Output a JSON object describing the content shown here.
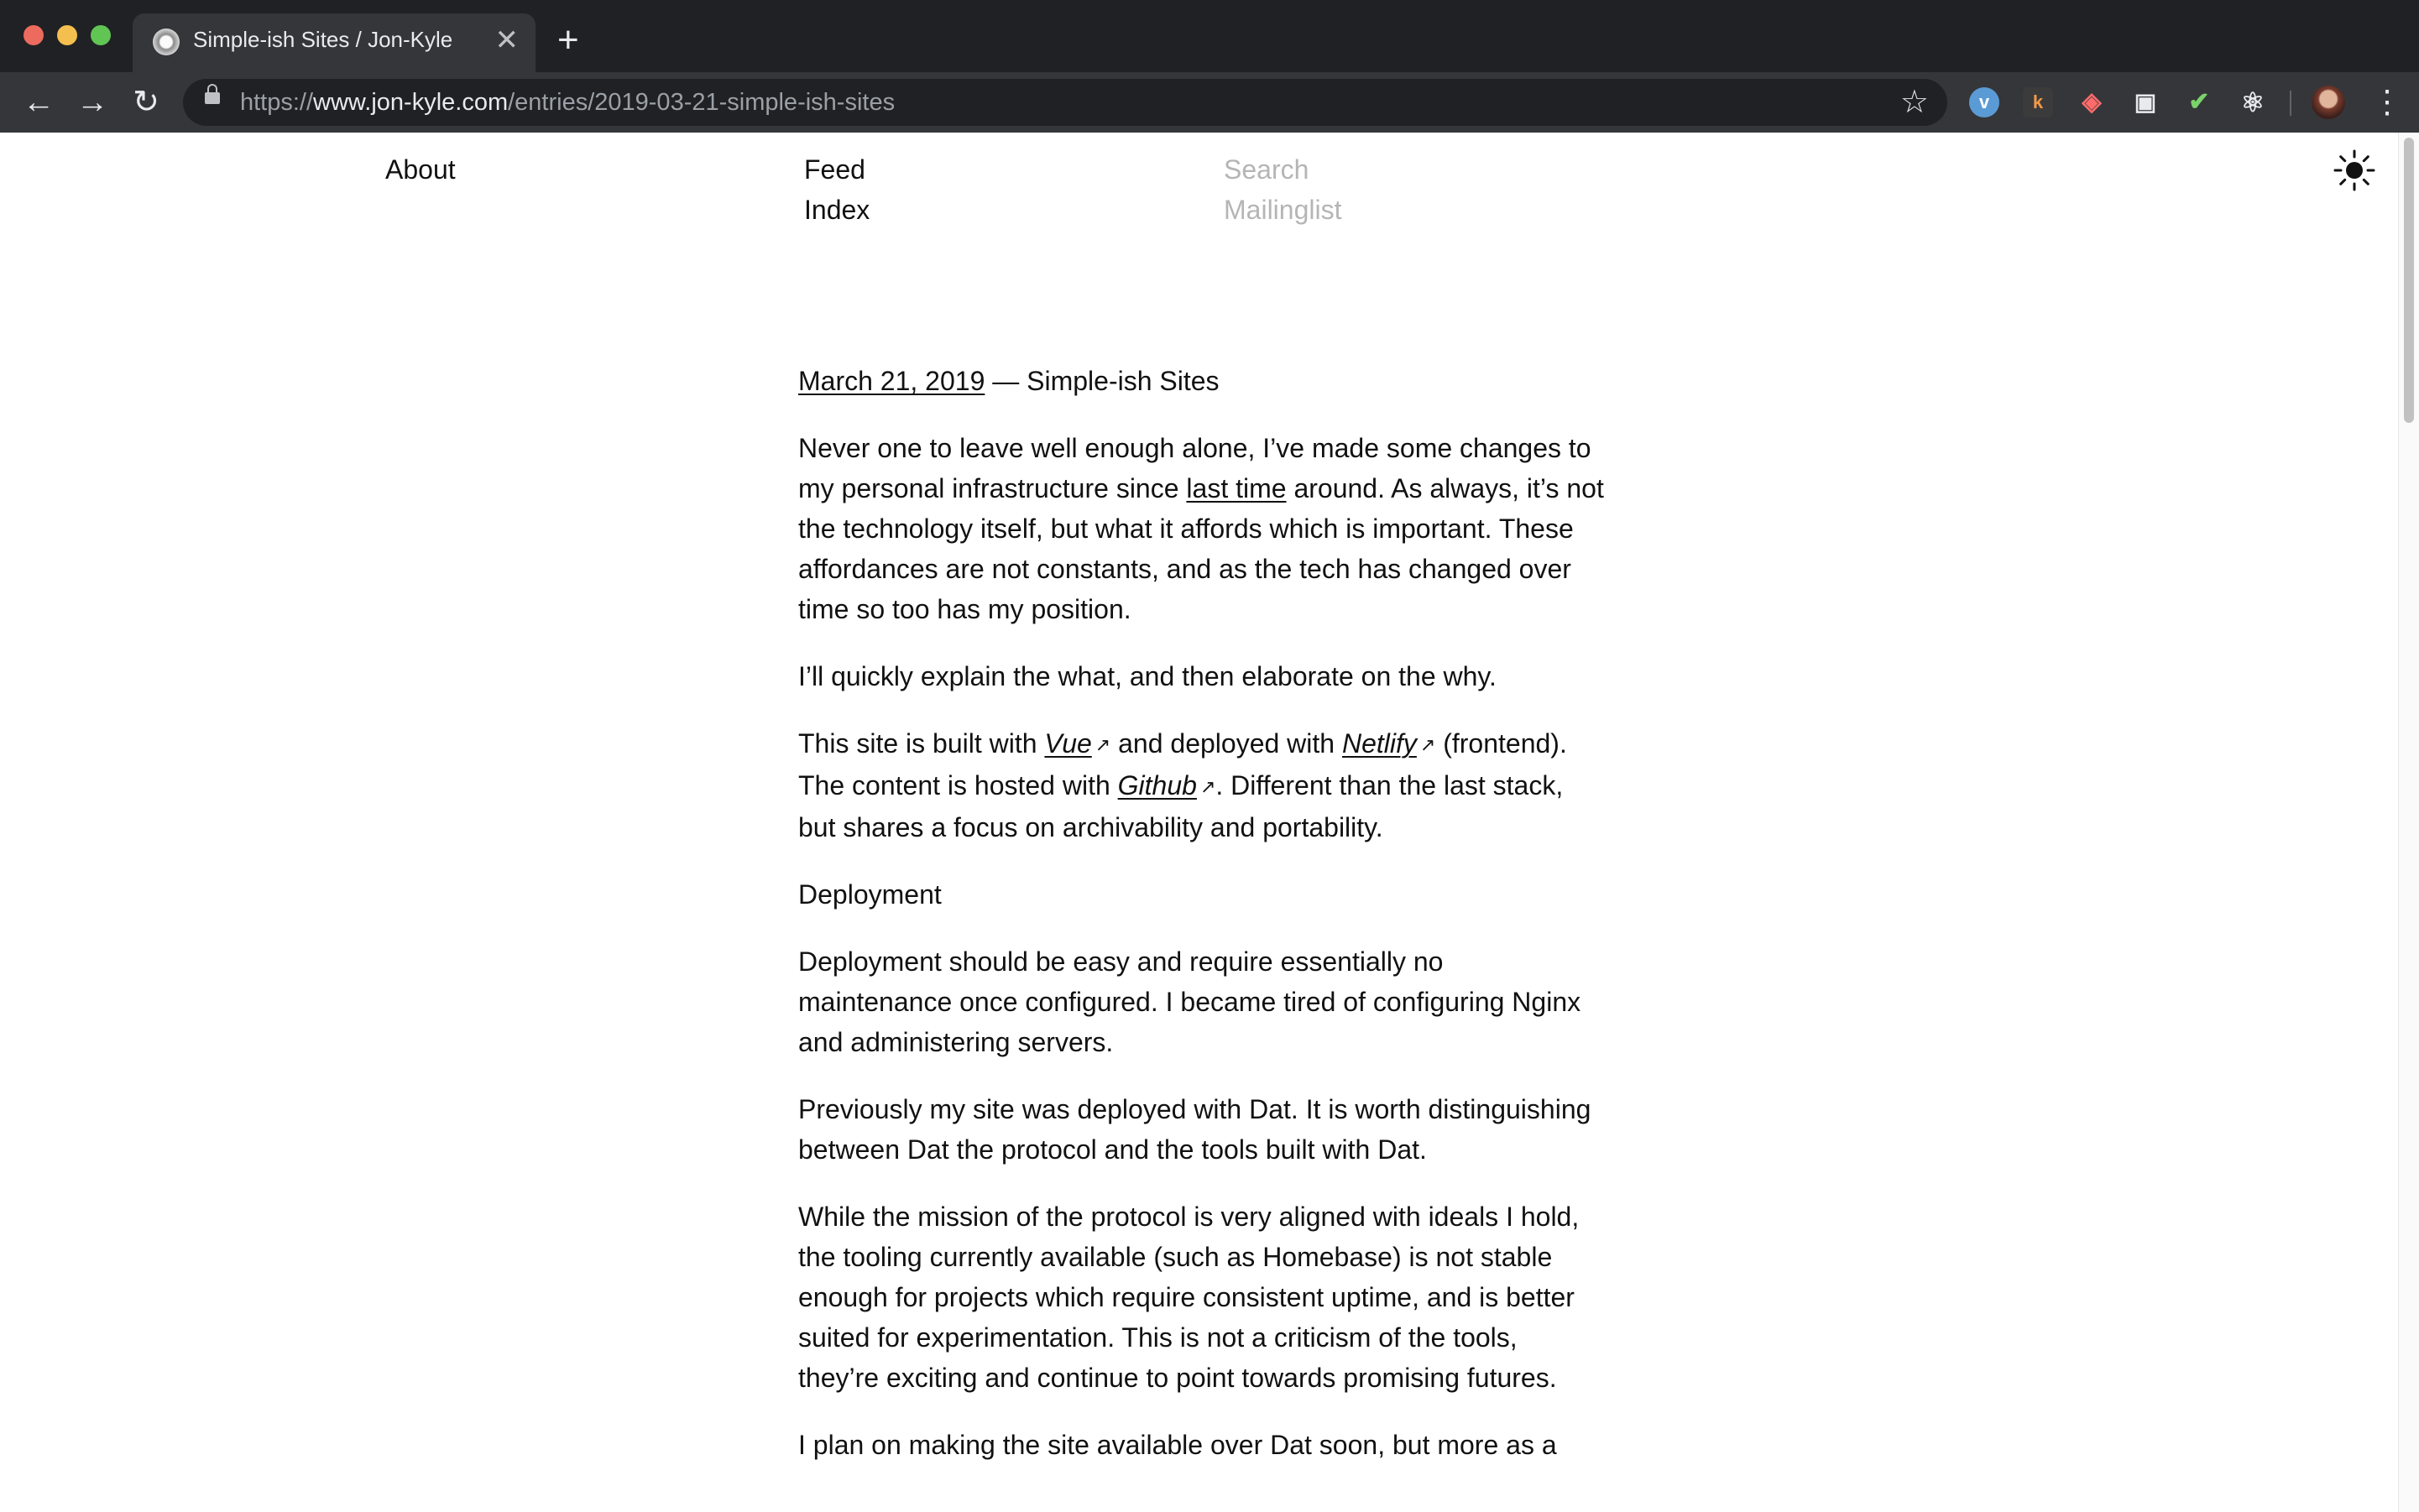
{
  "browser": {
    "tab_title": "Simple-ish Sites / Jon-Kyle",
    "tab_close": "✕",
    "new_tab": "+",
    "url_scheme": "https://",
    "url_host": "www.jon-kyle.com",
    "url_path": "/entries/2019-03-21-simple-ish-sites",
    "back": "←",
    "forward": "→",
    "reload": "↻",
    "star": "☆",
    "menu": "⋮",
    "extensions": [
      "v",
      "k",
      "◈",
      "▣",
      "✔",
      "⚛"
    ]
  },
  "site_nav": {
    "about": "About",
    "feed": "Feed",
    "index": "Index",
    "search": "Search",
    "mailinglist": "Mailinglist",
    "theme_icon": "sun-icon"
  },
  "entry": {
    "date": "March 21, 2019",
    "separator": " — ",
    "title": "Simple-ish Sites",
    "p1_a": "Never one to leave well enough alone, I’ve made some changes to my personal infrastructure since ",
    "p1_link": "last time",
    "p1_b": " around. As always, it’s not the technology itself, but what it affords which is important. These affordances are not constants, and as the tech has changed over time so too has my position.",
    "p2": "I’ll quickly explain the what, and then elaborate on the why.",
    "p3_a": "This site is built with ",
    "p3_vue": "Vue",
    "p3_b": " and deployed with ",
    "p3_netlify": "Netlify",
    "p3_c": " (frontend). The content is hosted with ",
    "p3_github": "Github",
    "p3_d": ". Different than the last stack, but shares a focus on archivability and portability.",
    "arrow": "↗",
    "section_deployment": "Deployment",
    "p4": "Deployment should be easy and require essentially no maintenance once configured. I became tired of configuring Nginx and administering servers.",
    "p5": "Previously my site was deployed with Dat. It is worth distinguishing between Dat the protocol and the tools built with Dat.",
    "p6": "While the mission of the protocol is very aligned with ideals I hold, the tooling currently available (such as Homebase) is not stable enough for projects which require consistent uptime, and is better suited for experimentation. This is not a criticism of the tools, they’re exciting and continue to point towards promising futures.",
    "p7": "I plan on making the site available over Dat soon, but more as a"
  }
}
